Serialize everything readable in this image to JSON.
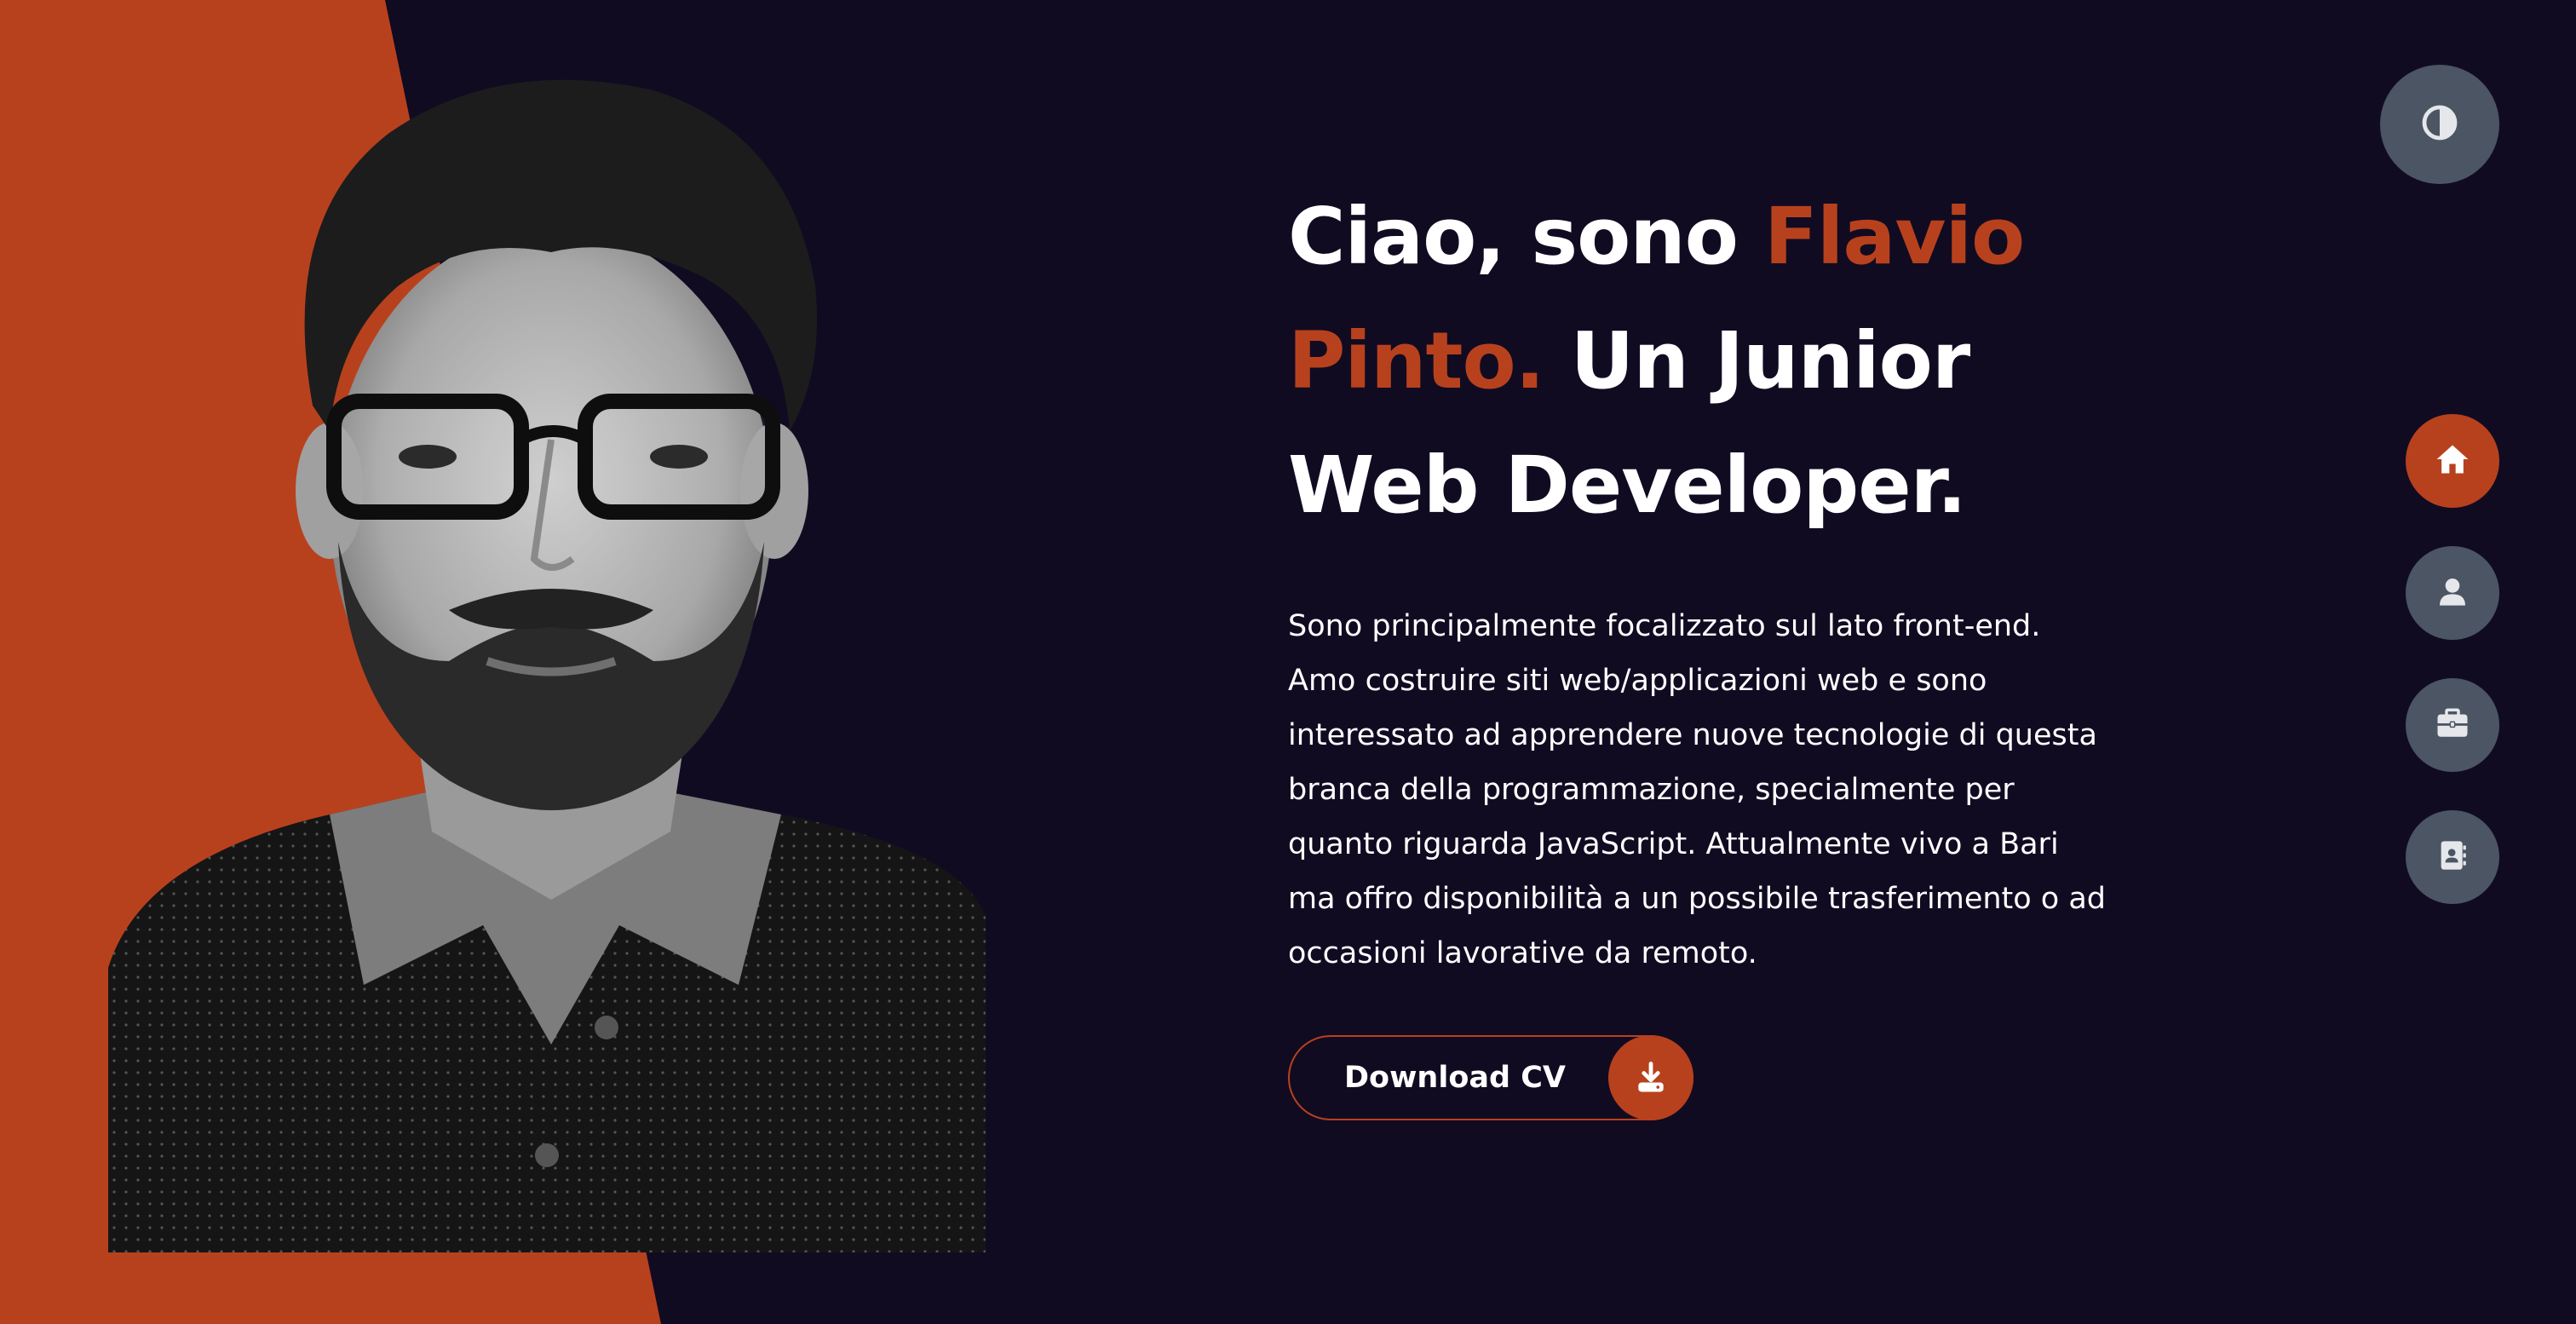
{
  "hero": {
    "headline_intro": "Ciao, sono ",
    "headline_name": "Flavio Pinto.",
    "headline_rest": " Un Junior Web Developer.",
    "bio": "Sono principalmente focalizzato sul lato front-end. Amo costruire siti web/applicazioni web e sono interessato ad apprendere nuove tecnologie di questa branca della programmazione, specialmente per quanto riguarda JavaScript. Attualmente vivo a Bari ma offro disponibilità a un possibile trasferimento o ad occasioni lavorative da remoto.",
    "cv_button_label": "Download CV",
    "cv_icon": "download-icon"
  },
  "theme_toggle": {
    "icon": "contrast-icon"
  },
  "nav": {
    "items": [
      {
        "icon": "home-icon",
        "active": true
      },
      {
        "icon": "user-icon",
        "active": false
      },
      {
        "icon": "briefcase-icon",
        "active": false
      },
      {
        "icon": "contact-book-icon",
        "active": false
      }
    ]
  },
  "colors": {
    "background": "#110b22",
    "accent": "#b8411d",
    "nav_button": "#4b5563",
    "text": "#ffffff"
  }
}
